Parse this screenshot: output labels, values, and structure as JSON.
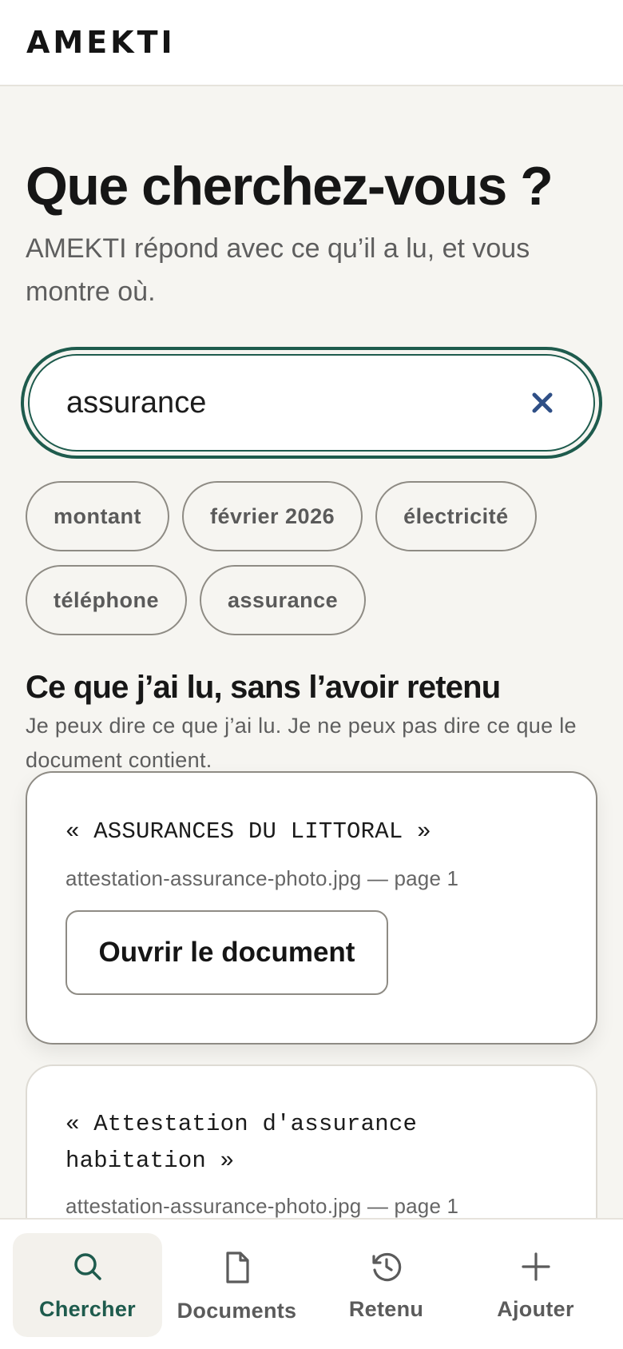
{
  "app": {
    "brand": "AMEKTI"
  },
  "hero": {
    "title": "Que cherchez-vous ?",
    "subtitle": "AMEKTI répond avec ce qu’il a lu, et vous montre où."
  },
  "search": {
    "value": "assurance",
    "clear_icon": "close-icon",
    "accent": "#1e5b4d",
    "clear_color": "#2f4f86"
  },
  "suggestions": [
    {
      "label": "montant"
    },
    {
      "label": "février 2026"
    },
    {
      "label": "électricité"
    },
    {
      "label": "téléphone"
    },
    {
      "label": "assurance"
    }
  ],
  "results_section": {
    "title": "Ce que j’ai lu, sans l’avoir retenu",
    "description": "Je peux dire ce que j’ai lu. Je ne peux pas dire ce que le document contient."
  },
  "results": [
    {
      "quote": "« ASSURANCES DU LITTORAL »",
      "source": "attestation-assurance-photo.jpg — page 1",
      "open_label": "Ouvrir le document"
    },
    {
      "quote": "« Attestation d'assurance habitation »",
      "source": "attestation-assurance-photo.jpg — page 1"
    }
  ],
  "tabbar": {
    "tabs": [
      {
        "label": "Chercher",
        "icon": "search-icon",
        "active": true
      },
      {
        "label": "Documents",
        "icon": "document-icon",
        "active": false
      },
      {
        "label": "Retenu",
        "icon": "history-icon",
        "active": false
      },
      {
        "label": "Ajouter",
        "icon": "plus-icon",
        "active": false
      }
    ]
  }
}
